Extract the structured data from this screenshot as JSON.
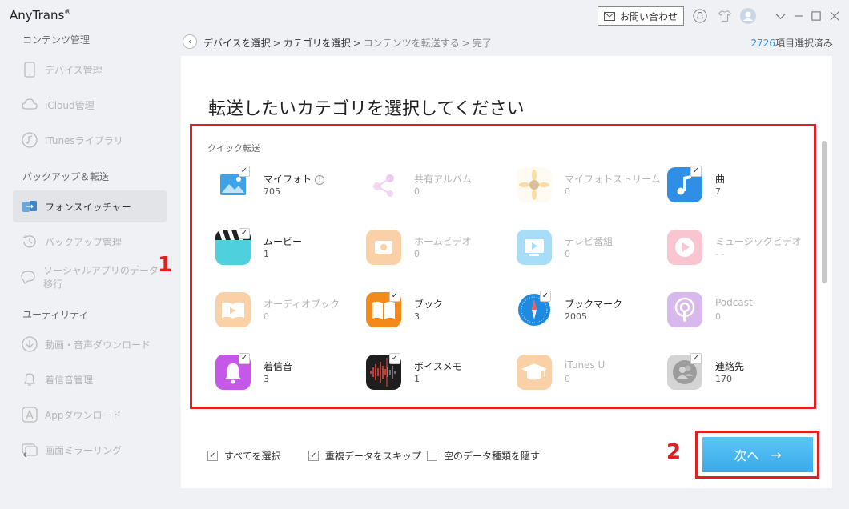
{
  "app": {
    "title": "AnyTrans",
    "title_mark": "®"
  },
  "topbar": {
    "contact_label": "お問い合わせ"
  },
  "sidebar": {
    "sections": [
      {
        "label": "コンテンツ管理"
      },
      {
        "label": "バックアップ＆転送"
      },
      {
        "label": "ユーティリティ"
      }
    ],
    "items": [
      {
        "label": "デバイス管理",
        "icon": "phone-icon"
      },
      {
        "label": "iCloud管理",
        "icon": "cloud-icon"
      },
      {
        "label": "iTunesライブラリ",
        "icon": "music-note-icon"
      },
      {
        "label": "フォンスイッチャー",
        "icon": "phone-switch-icon",
        "active": true
      },
      {
        "label": "バックアップ管理",
        "icon": "history-icon"
      },
      {
        "label": "ソーシャルアプリのデータ移行",
        "icon": "chat-icon"
      },
      {
        "label": "動画・音声ダウンロード",
        "icon": "download-icon"
      },
      {
        "label": "着信音管理",
        "icon": "bell-icon"
      },
      {
        "label": "Appダウンロード",
        "icon": "app-store-icon"
      },
      {
        "label": "画面ミラーリング",
        "icon": "mirror-icon"
      }
    ]
  },
  "breadcrumb": {
    "steps": [
      "デバイスを選択",
      "カテゴリを選択",
      "コンテンツを転送する",
      "完了"
    ],
    "separator": ">"
  },
  "selection": {
    "count": "2726",
    "suffix": "項目選択済み"
  },
  "main": {
    "heading": "転送したいカテゴリを選択してください",
    "quick_label": "クイック転送",
    "categories": [
      {
        "name": "マイフォト",
        "count": "705",
        "checked": true,
        "enabled": true,
        "icon": "photos-icon",
        "info": "!"
      },
      {
        "name": "共有アルバム",
        "count": "0",
        "checked": false,
        "enabled": false,
        "icon": "shared-album-icon"
      },
      {
        "name": "マイフォトストリーム",
        "count": "0",
        "checked": false,
        "enabled": false,
        "icon": "photo-stream-icon"
      },
      {
        "name": "曲",
        "count": "7",
        "checked": true,
        "enabled": true,
        "icon": "song-icon"
      },
      {
        "name": "ムービー",
        "count": "1",
        "checked": true,
        "enabled": true,
        "icon": "movie-icon"
      },
      {
        "name": "ホームビデオ",
        "count": "0",
        "checked": false,
        "enabled": false,
        "icon": "home-video-icon"
      },
      {
        "name": "テレビ番組",
        "count": "0",
        "checked": false,
        "enabled": false,
        "icon": "tv-show-icon"
      },
      {
        "name": "ミュージックビデオ",
        "count": "- -",
        "checked": false,
        "enabled": false,
        "icon": "music-video-icon"
      },
      {
        "name": "オーディオブック",
        "count": "0",
        "checked": false,
        "enabled": false,
        "icon": "audiobook-icon"
      },
      {
        "name": "ブック",
        "count": "3",
        "checked": true,
        "enabled": true,
        "icon": "book-icon"
      },
      {
        "name": "ブックマーク",
        "count": "2005",
        "checked": true,
        "enabled": true,
        "icon": "bookmark-icon"
      },
      {
        "name": "Podcast",
        "count": "0",
        "checked": false,
        "enabled": false,
        "icon": "podcast-icon"
      },
      {
        "name": "着信音",
        "count": "3",
        "checked": true,
        "enabled": true,
        "icon": "ringtone-icon"
      },
      {
        "name": "ボイスメモ",
        "count": "1",
        "checked": true,
        "enabled": true,
        "icon": "voice-memo-icon"
      },
      {
        "name": "iTunes U",
        "count": "0",
        "checked": false,
        "enabled": false,
        "icon": "itunes-u-icon"
      },
      {
        "name": "連絡先",
        "count": "170",
        "checked": true,
        "enabled": true,
        "icon": "contacts-icon"
      }
    ]
  },
  "options": [
    {
      "label": "すべてを選択",
      "checked": true
    },
    {
      "label": "重複データをスキップ",
      "checked": true
    },
    {
      "label": "空のデータ種類を隠す",
      "checked": false
    }
  ],
  "next_button": {
    "label": "次へ",
    "arrow": "→"
  },
  "annotations": {
    "marker_1": "1",
    "marker_2": "2"
  },
  "colors": {
    "accent": "#3d8fd6",
    "button": "#44b3f0",
    "highlight": "#e02020"
  }
}
